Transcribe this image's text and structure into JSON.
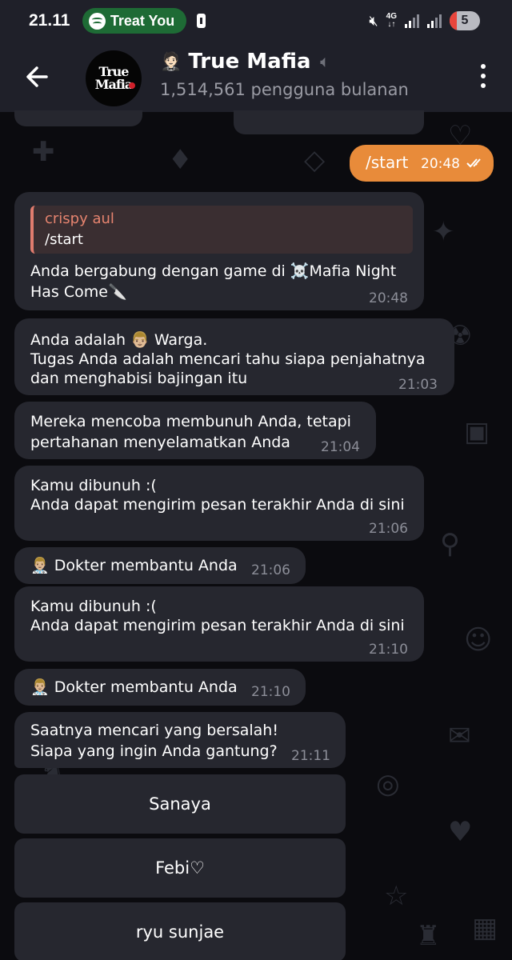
{
  "statusbar": {
    "time": "21.11",
    "now_playing": "Treat You",
    "network": "4G",
    "battery_level": "5"
  },
  "header": {
    "back_icon": "arrow-left-icon",
    "avatar_text_line1": "True",
    "avatar_text_line2": "Mafia",
    "title_emoji": "🤵🏻",
    "title": "True Mafia",
    "muted_icon": "🔇",
    "subtitle": "1,514,561 pengguna bulanan",
    "menu_icon": "more-vertical-icon"
  },
  "messages": {
    "outgoing_start": {
      "text": "/start",
      "time": "20:48"
    },
    "joined": {
      "reply_name": "crispy aul",
      "reply_text": "/start",
      "line1": "Anda bergabung dengan game di ☠️Mafia Night",
      "line2": "Has Come🔪",
      "time": "20:48"
    },
    "role": {
      "line1": "Anda adalah 👨🏼 Warga.",
      "line2": "Tugas Anda adalah mencari tahu siapa penjahatnya",
      "line3": "dan menghabisi bajingan itu",
      "time": "21:03"
    },
    "saved": {
      "line1": "Mereka mencoba membunuh Anda, tetapi",
      "line2": "pertahanan menyelamatkan Anda",
      "time": "21:04"
    },
    "killed1": {
      "line1": "Kamu dibunuh :(",
      "line2": "Anda dapat mengirim pesan terakhir Anda di sini",
      "time": "21:06"
    },
    "doctor1": {
      "text": "👨🏼‍⚕️ Dokter membantu Anda",
      "time": "21:06"
    },
    "killed2": {
      "line1": "Kamu dibunuh :(",
      "line2": "Anda dapat mengirim pesan terakhir Anda di sini",
      "time": "21:10"
    },
    "doctor2": {
      "text": "👨🏼‍⚕️ Dokter membantu Anda",
      "time": "21:10"
    },
    "vote": {
      "line1": "Saatnya mencari yang bersalah!",
      "line2": "Siapa yang ingin Anda gantung?",
      "time": "21:11"
    }
  },
  "vote_buttons": [
    "Sanaya",
    "Febi♡",
    "ryu sunjae"
  ],
  "colors": {
    "bubble": "#26272f",
    "outgoing": "#e88b3a",
    "header": "#1f2029",
    "reply_accent": "#e07c6e"
  }
}
